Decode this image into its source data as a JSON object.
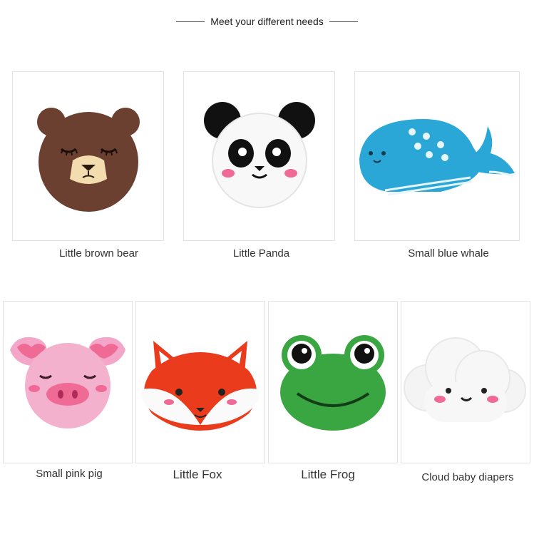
{
  "header": {
    "title": "Meet your different needs"
  },
  "products": [
    {
      "name": "Little brown bear",
      "icon": "bear-icon"
    },
    {
      "name": "Little Panda",
      "icon": "panda-icon"
    },
    {
      "name": "Small blue whale",
      "icon": "whale-icon"
    },
    {
      "name": "Small pink pig",
      "icon": "pig-icon"
    },
    {
      "name": "Little Fox",
      "icon": "fox-icon"
    },
    {
      "name": "Little Frog",
      "icon": "frog-icon"
    },
    {
      "name": "Cloud baby diapers",
      "icon": "cloud-icon"
    }
  ],
  "colors": {
    "bear": "#6b4030",
    "whale": "#2aa7d6",
    "pig": "#f4a6c8",
    "fox": "#ea3b1c",
    "frog": "#3aa641",
    "blush": "#f06a96"
  }
}
